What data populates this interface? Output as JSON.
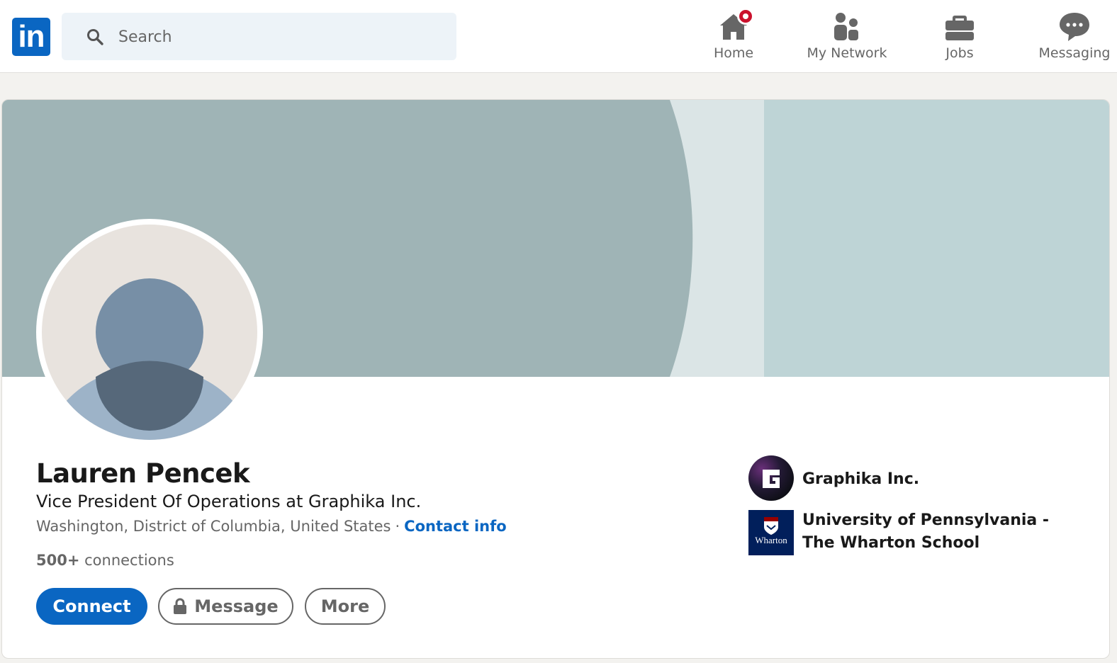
{
  "nav": {
    "logo_text": "in",
    "search": {
      "placeholder": "Search"
    },
    "items": [
      {
        "label": "Home",
        "icon": "home-icon",
        "has_notification": true
      },
      {
        "label": "My Network",
        "icon": "people-icon"
      },
      {
        "label": "Jobs",
        "icon": "briefcase-icon"
      },
      {
        "label": "Messaging",
        "icon": "chat-icon"
      }
    ]
  },
  "profile": {
    "name": "Lauren Pencek",
    "headline": "Vice President Of Operations at Graphika Inc.",
    "location": "Washington, District of Columbia, United States",
    "separator": "·",
    "contact_info_label": "Contact info",
    "connections_count": "500+",
    "connections_label": "connections",
    "actions": {
      "connect": "Connect",
      "message": "Message",
      "more": "More"
    },
    "organizations": [
      {
        "name": "Graphika Inc.",
        "logo_text": "G"
      },
      {
        "name": "University of Pennsylvania - The Wharton School",
        "logo_text": "Wharton"
      }
    ]
  },
  "colors": {
    "brand": "#0a66c2",
    "banner_dark": "#9fb4b6",
    "banner_light": "#bed4d6",
    "notification": "#cb112d"
  }
}
